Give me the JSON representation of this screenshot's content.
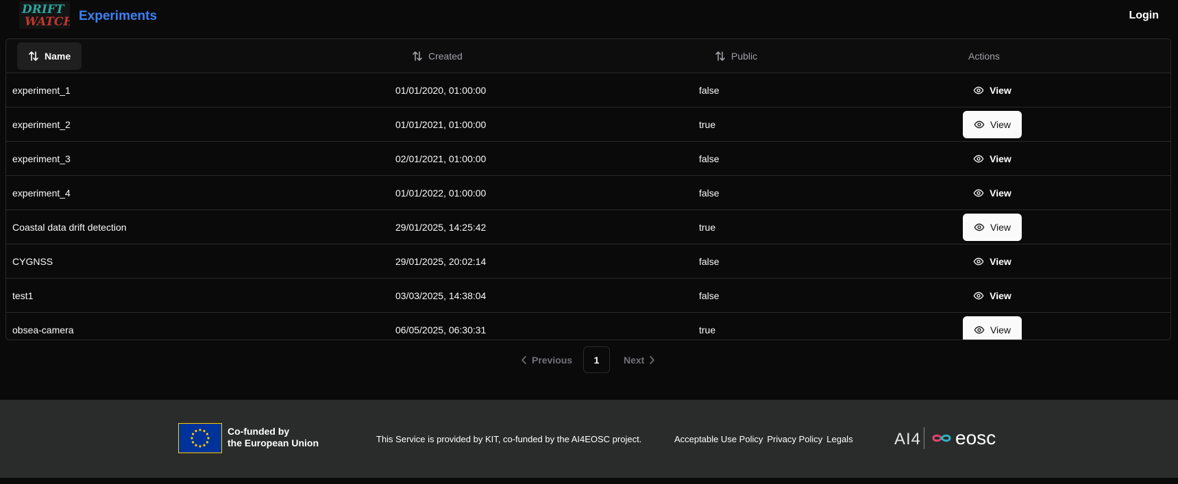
{
  "header": {
    "logo_alt": "DRIFT WATCH",
    "logo_line1": "DRIFT",
    "logo_line2": "WATCH",
    "title": "Experiments",
    "login_label": "Login"
  },
  "table": {
    "columns": {
      "name": "Name",
      "created": "Created",
      "public": "Public",
      "actions": "Actions"
    },
    "rows": [
      {
        "name": "experiment_1",
        "created": "01/01/2020, 01:00:00",
        "public": "false",
        "action": "View",
        "style": "ghost"
      },
      {
        "name": "experiment_2",
        "created": "01/01/2021, 01:00:00",
        "public": "true",
        "action": "View",
        "style": "light"
      },
      {
        "name": "experiment_3",
        "created": "02/01/2021, 01:00:00",
        "public": "false",
        "action": "View",
        "style": "ghost"
      },
      {
        "name": "experiment_4",
        "created": "01/01/2022, 01:00:00",
        "public": "false",
        "action": "View",
        "style": "ghost"
      },
      {
        "name": "Coastal data drift detection",
        "created": "29/01/2025, 14:25:42",
        "public": "true",
        "action": "View",
        "style": "light"
      },
      {
        "name": "CYGNSS",
        "created": "29/01/2025, 20:02:14",
        "public": "false",
        "action": "View",
        "style": "ghost"
      },
      {
        "name": "test1",
        "created": "03/03/2025, 14:38:04",
        "public": "false",
        "action": "View",
        "style": "ghost"
      },
      {
        "name": "obsea-camera",
        "created": "06/05/2025, 06:30:31",
        "public": "true",
        "action": "View",
        "style": "light"
      }
    ]
  },
  "pagination": {
    "previous_label": "Previous",
    "current_page": "1",
    "next_label": "Next"
  },
  "footer": {
    "eu_line1": "Co-funded by",
    "eu_line2": "the European Union",
    "provided_text": "This Service is provided by KIT, co-funded by the AI4EOSC project.",
    "links": [
      "Acceptable Use Policy",
      "Privacy Policy",
      "Legals"
    ],
    "ai4_label": "AI4",
    "eosc_label": "eosc"
  },
  "colors": {
    "accent": "#3b82f6",
    "background": "#0a0a0a",
    "footer_bg": "#2a2b2b",
    "eu_blue": "#003399",
    "eu_gold": "#ffcc00"
  }
}
